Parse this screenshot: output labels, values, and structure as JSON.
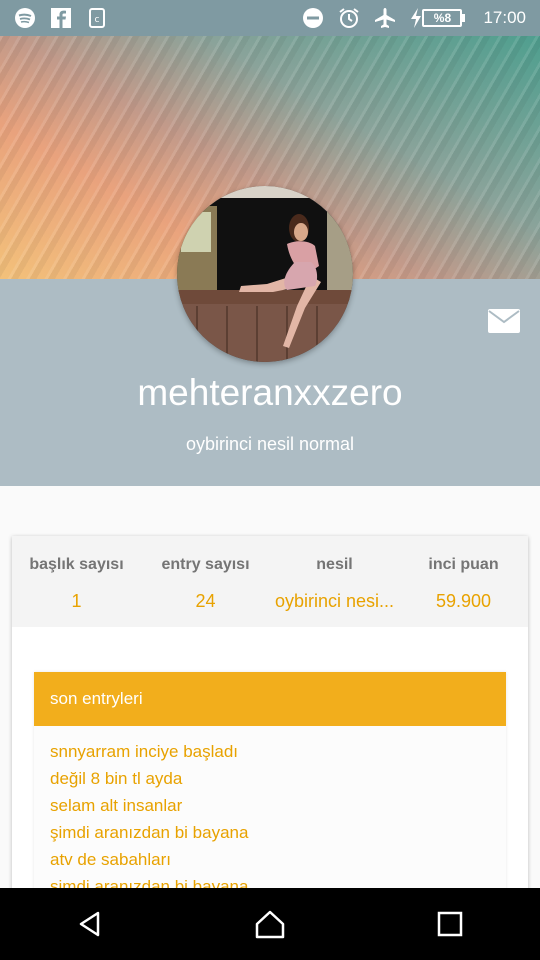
{
  "status_bar": {
    "time": "17:00",
    "battery": "%8",
    "left_icons": [
      "spotify-icon",
      "facebook-icon",
      "clipboard-icon"
    ],
    "right_icons": [
      "do-not-disturb-icon",
      "alarm-icon",
      "airplane-mode-icon",
      "charging-icon",
      "battery-icon"
    ]
  },
  "profile": {
    "username": "mehteranxxzero",
    "subtitle": "oybirinci nesil normal",
    "mail_icon": "mail-icon",
    "avatar_icon": "avatar"
  },
  "stats": [
    {
      "label": "başlık sayısı",
      "value": "1"
    },
    {
      "label": "entry sayısı",
      "value": "24"
    },
    {
      "label": "nesil",
      "value": "oybirinci nesi..."
    },
    {
      "label": "inci puan",
      "value": "59.900"
    }
  ],
  "entries_section": {
    "title": "son entryleri",
    "items": [
      "snnyarram inciye başladı",
      "değil 8 bin tl ayda",
      "selam alt insanlar",
      "şimdi aranızdan bi bayana",
      "atv de sabahları",
      "şimdi aranızdan bi bayana"
    ]
  },
  "nav": {
    "back": "back-icon",
    "home": "home-icon",
    "recents": "recents-icon"
  },
  "colors": {
    "accent": "#f2ae1c",
    "link": "#e8a200",
    "band": "#adbcc4",
    "status_bar": "#7f9aa2"
  }
}
